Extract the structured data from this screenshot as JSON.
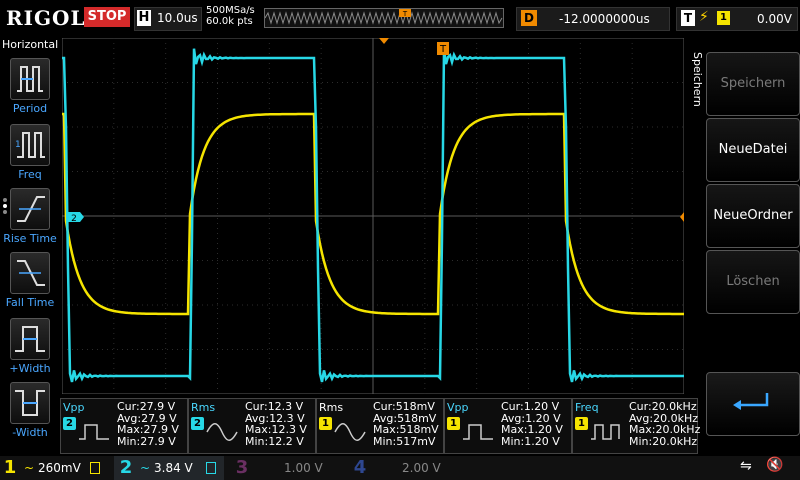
{
  "topbar": {
    "brand": "RIGOL",
    "run_state": "STOP",
    "timebase_label": "H",
    "timebase_value": "10.0us",
    "sample_rate": "500MSa/s",
    "memory_depth": "60.0k pts",
    "delay_label": "D",
    "delay_value": "-12.0000000us",
    "trigger_label": "T",
    "trigger_source": "1",
    "trigger_level": "0.00V",
    "colors": {
      "run_state_bg": "#d42a2a",
      "delay_bg": "#f08a00"
    }
  },
  "horizontal_menu": {
    "title": "Horizontal",
    "items": [
      {
        "label": "Period",
        "icon": "period-icon"
      },
      {
        "label": "Freq",
        "icon": "frequency-icon"
      },
      {
        "label": "Rise Time",
        "icon": "rise-time-icon"
      },
      {
        "label": "Fall Time",
        "icon": "fall-time-icon"
      },
      {
        "label": "+Width",
        "icon": "positive-width-icon"
      },
      {
        "label": "-Width",
        "icon": "negative-width-icon"
      }
    ]
  },
  "markers": {
    "ch2_ground": "2",
    "trigger_pos": "T",
    "trigger_level": "T"
  },
  "save_menu": {
    "title": "Speichern",
    "buttons": [
      {
        "label": "Speichern",
        "enabled": false
      },
      {
        "label": "NeueDatei",
        "enabled": true
      },
      {
        "label": "NeueOrdner",
        "enabled": true
      },
      {
        "label": "Löschen",
        "enabled": false
      }
    ],
    "back_icon": "return-arrow-icon"
  },
  "measurements": [
    {
      "name": "Vpp",
      "source": "2",
      "cur": "Cur:27.9 V",
      "avg": "Avg:27.9 V",
      "max": "Max:27.9 V",
      "min": "Min:27.9 V"
    },
    {
      "name": "Rms",
      "source": "2",
      "cur": "Cur:12.3 V",
      "avg": "Avg:12.3 V",
      "max": "Max:12.3 V",
      "min": "Min:12.2 V"
    },
    {
      "name": "Rms",
      "source": "1",
      "cur": "Cur:518mV",
      "avg": "Avg:518mV",
      "max": "Max:518mV",
      "min": "Min:517mV"
    },
    {
      "name": "Vpp",
      "source": "1",
      "cur": "Cur:1.20 V",
      "avg": "Avg:1.20 V",
      "max": "Max:1.20 V",
      "min": "Min:1.20 V"
    },
    {
      "name": "Freq",
      "source": "1",
      "cur": "Cur:20.0kHz",
      "avg": "Avg:20.0kHz",
      "max": "Max:20.0kHz",
      "min": "Min:20.0kHz"
    }
  ],
  "channels": [
    {
      "num": "1",
      "value": "260mV",
      "color": "#f5e400",
      "coupling": "~",
      "active": true
    },
    {
      "num": "2",
      "value": "3.84 V",
      "color": "#27d8e6",
      "coupling": "~",
      "active": true
    },
    {
      "num": "3",
      "value": "1.00 V",
      "color": "#b0389b",
      "coupling": "",
      "active": false
    },
    {
      "num": "4",
      "value": "2.00 V",
      "color": "#3d63c9",
      "coupling": "",
      "active": false
    }
  ],
  "status": {
    "usb_icon": "usb-icon",
    "sound_icon": "speaker-muted-icon"
  },
  "colors": {
    "ch1": "#f5e400",
    "ch2": "#27d8e6",
    "grid": "#3a3a3a",
    "trigger": "#f08a00"
  }
}
